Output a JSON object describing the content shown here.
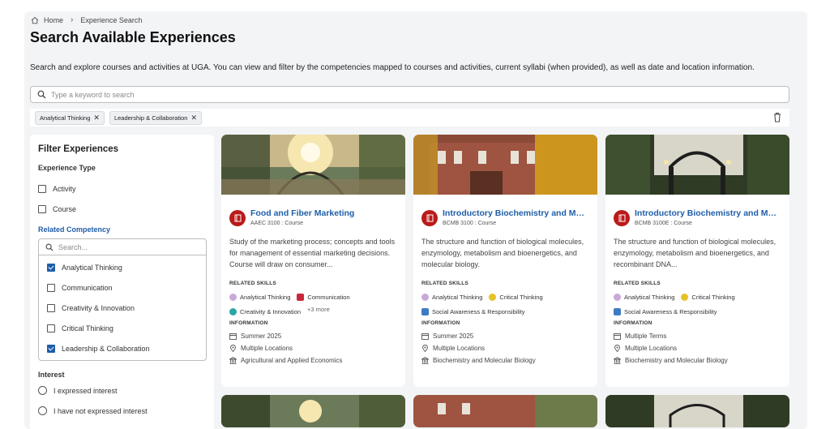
{
  "breadcrumb": {
    "home": "Home",
    "current": "Experience Search"
  },
  "page": {
    "title": "Search Available Experiences",
    "description": "Search and explore courses and activities at UGA. You can view and filter by the competencies mapped to courses and activities, current syllabi (when provided), as well as date and location information."
  },
  "search": {
    "placeholder": "Type a keyword to search",
    "value": ""
  },
  "active_filters": [
    "Analytical Thinking",
    "Leadership & Collaboration"
  ],
  "filters": {
    "title": "Filter Experiences",
    "experience_type": {
      "label": "Experience Type",
      "options": [
        {
          "label": "Activity",
          "checked": false
        },
        {
          "label": "Course",
          "checked": false
        }
      ]
    },
    "related_competency": {
      "label": "Related Competency",
      "search_placeholder": "Search...",
      "options": [
        {
          "label": "Analytical Thinking",
          "checked": true
        },
        {
          "label": "Communication",
          "checked": false
        },
        {
          "label": "Creativity & Innovation",
          "checked": false
        },
        {
          "label": "Critical Thinking",
          "checked": false
        },
        {
          "label": "Leadership & Collaboration",
          "checked": true
        }
      ]
    },
    "interest": {
      "label": "Interest",
      "options": [
        "I expressed interest",
        "I have not expressed interest"
      ]
    }
  },
  "cards": [
    {
      "title": "Food and Fiber Marketing",
      "code": "AAEC 3100 : Course",
      "description": "Study of the marketing process; concepts and tools for management of essential marketing decisions. Course will draw on consumer...",
      "skills_label": "RELATED SKILLS",
      "skills": [
        "Analytical Thinking",
        "Communication",
        "Creativity & Innovation"
      ],
      "more": "+3 more",
      "info_label": "INFORMATION",
      "term": "Summer 2025",
      "location": "Multiple Locations",
      "department": "Agricultural and Applied Economics"
    },
    {
      "title": "Introductory Biochemistry and Molecular Biology",
      "code": "BCMB 3100 : Course",
      "description": "The structure and function of biological molecules, enzymology, metabolism and bioenergetics, and molecular biology.",
      "skills_label": "RELATED SKILLS",
      "skills": [
        "Analytical Thinking",
        "Critical Thinking",
        "Social Awareness & Responsibility"
      ],
      "info_label": "INFORMATION",
      "term": "Summer 2025",
      "location": "Multiple Locations",
      "department": "Biochemistry and Molecular Biology"
    },
    {
      "title": "Introductory Biochemistry and Molecular Biology",
      "code": "BCMB 3100E : Course",
      "description": "The structure and function of biological molecules, enzymology, metabolism and bioenergetics, and recombinant DNA...",
      "skills_label": "RELATED SKILLS",
      "skills": [
        "Analytical Thinking",
        "Critical Thinking",
        "Social Awareness & Responsibility"
      ],
      "info_label": "INFORMATION",
      "term": "Multiple Terms",
      "location": "Multiple Locations",
      "department": "Biochemistry and Molecular Biology"
    }
  ],
  "colors": {
    "accent": "#1f5ea8",
    "course_icon": "#ba1a1a",
    "page_bg": "#f3f4f6"
  }
}
